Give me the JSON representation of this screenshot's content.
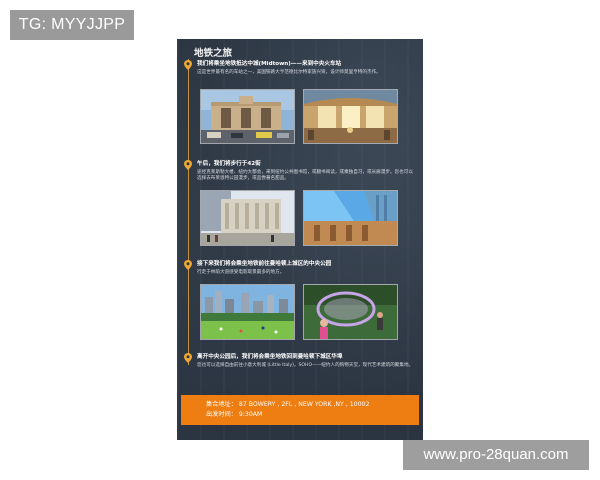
{
  "watermark_top": "TG: MYYJJPP",
  "watermark_bottom": "www.pro-28quan.com",
  "poster": {
    "title": "地铁之旅",
    "accent_color": "#ee7d12",
    "sections": [
      {
        "heading": "我们将乘坐地铁抵达中城(Midtown)——来到中央火车站",
        "body": "这是世界最有名的车站之一，美国铁路大亨范德比尔特家族兴资，设计师莫里亨特的杰作。",
        "photos": [
          "grand-central-exterior-photo",
          "grand-central-concourse-photo"
        ]
      },
      {
        "heading": "午后，我们将步行于42街",
        "body": "途径克莱斯勒大楼、纽约大都会，来到纽约公共图书馆，或翻书阅读，或乘独自习，或长廊漫步。您也可以选择去布莱恩特公园漫步，或品尝著名甜品。",
        "photos": [
          "public-library-photo",
          "skyscraper-view-photo"
        ]
      },
      {
        "heading": "接下来我们将会乘坐地铁前往曼哈顿上城区的中央公园",
        "body": "行走于林荫大道感受电影取景最多的地方。",
        "photos": [
          "central-park-lawn-photo",
          "bubble-performer-photo"
        ]
      },
      {
        "heading": "离开中央公园后，我们将会乘坐地铁回到曼哈顿下城区华埠",
        "body": "您也可以选择自由前往小意大利城 (Little Italy)，SOHO——纽约人的购物天堂，现代艺术建筑的聚集地。",
        "photos": []
      }
    ],
    "info": {
      "address_label": "集合地址：",
      "address_value": "87 BOWERY , 2FL , NEW YORK ,NY , 10002",
      "time_label": "出发时间：",
      "time_value": "9:30AM"
    }
  }
}
